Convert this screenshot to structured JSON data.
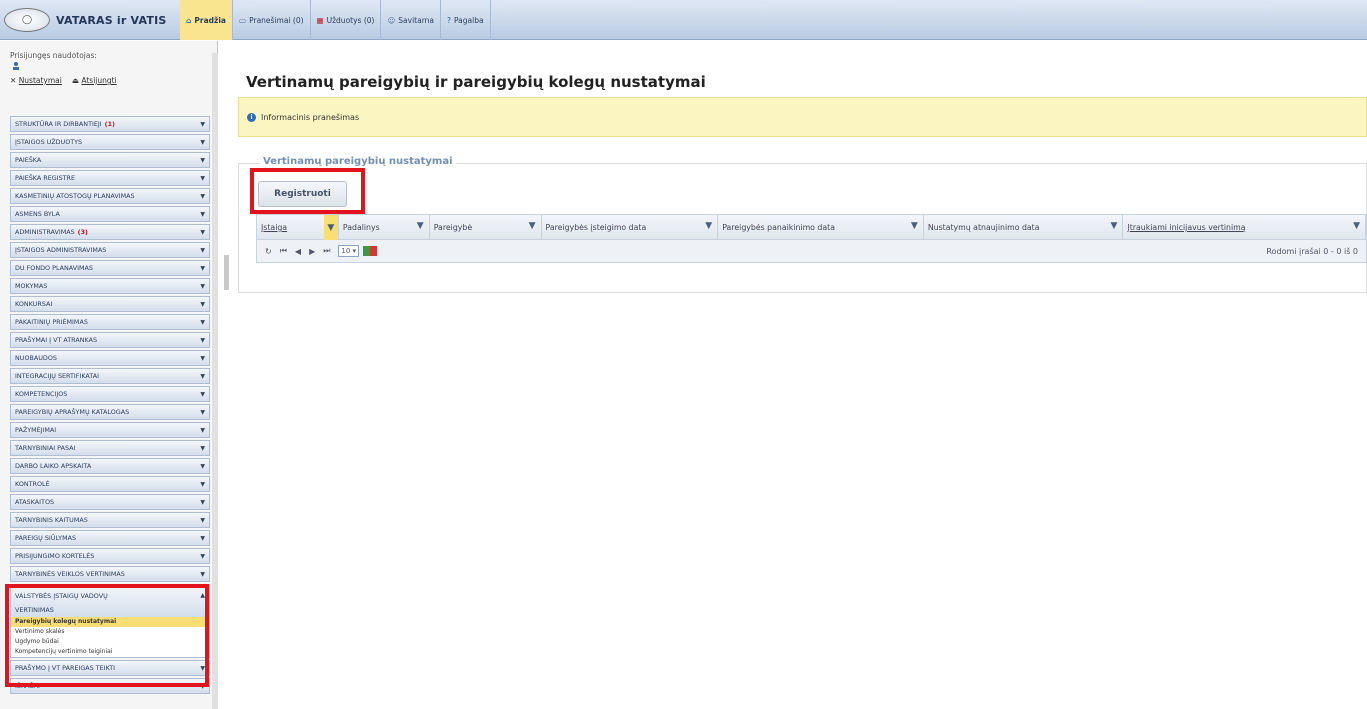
{
  "topbar": {
    "brand": "VATARAS ir VATIS",
    "logo_text": "◯",
    "nav": [
      {
        "label": "Pradžia",
        "active": true,
        "icon": "home-icon"
      },
      {
        "label": "Pranešimai (0)",
        "active": false,
        "icon": "message-icon"
      },
      {
        "label": "Užduotys (0)",
        "active": false,
        "icon": "calendar-icon"
      },
      {
        "label": "Savitarna",
        "active": false,
        "icon": "people-icon"
      },
      {
        "label": "Pagalba",
        "active": false,
        "icon": "help-icon"
      }
    ]
  },
  "sidebar": {
    "user_label": "Prisijungęs naudotojas:",
    "settings_link": "Nustatymai",
    "logout_link": "Atsijungti",
    "menu": [
      {
        "label": "STRUKTŪRA IR DIRBANTIEJI",
        "badge": "(1)"
      },
      {
        "label": "ĮSTAIGOS UŽDUOTYS",
        "badge": ""
      },
      {
        "label": "PAIEŠKA",
        "badge": ""
      },
      {
        "label": "PAIEŠKA REGISTRE",
        "badge": ""
      },
      {
        "label": "KASMETINIŲ ATOSTOGŲ PLANAVIMAS",
        "badge": ""
      },
      {
        "label": "ASMENS BYLA",
        "badge": ""
      },
      {
        "label": "ADMINISTRAVIMAS",
        "badge": "(3)"
      },
      {
        "label": "ĮSTAIGOS ADMINISTRAVIMAS",
        "badge": ""
      },
      {
        "label": "DU FONDO PLANAVIMAS",
        "badge": ""
      },
      {
        "label": "MOKYMAS",
        "badge": ""
      },
      {
        "label": "KONKURSAI",
        "badge": ""
      },
      {
        "label": "PAKAITINIŲ PRIĖMIMAS",
        "badge": ""
      },
      {
        "label": "PRAŠYMAI Į VT ATRANKAS",
        "badge": ""
      },
      {
        "label": "NUOBAUDOS",
        "badge": ""
      },
      {
        "label": "INTEGRACIJŲ SERTIFIKATAI",
        "badge": ""
      },
      {
        "label": "KOMPETENCIJOS",
        "badge": ""
      },
      {
        "label": "PAREIGYBIŲ APRAŠYMŲ KATALOGAS",
        "badge": ""
      },
      {
        "label": "PAŽYMĖJIMAI",
        "badge": ""
      },
      {
        "label": "TARNYBINIAI PASAI",
        "badge": ""
      },
      {
        "label": "DARBO LAIKO APSKAITA",
        "badge": ""
      },
      {
        "label": "KONTROLĖ",
        "badge": ""
      },
      {
        "label": "ATASKAITOS",
        "badge": ""
      },
      {
        "label": "TARNYBINIS KAITUMAS",
        "badge": ""
      },
      {
        "label": "PAREIGŲ SIŪLYMAS",
        "badge": ""
      },
      {
        "label": "PRISIJUNGIMO KORTELĖS",
        "badge": ""
      },
      {
        "label": "TARNYBINĖS VEIKLOS VERTINIMAS",
        "badge": ""
      }
    ],
    "expanded": {
      "label_line1": "VALSTYBĖS ĮSTAIGŲ VADOVŲ",
      "label_line2": "VERTINIMAS",
      "items": [
        {
          "label": "Pareigybių kolegų nustatymai",
          "selected": true
        },
        {
          "label": "Vertinimo skalės",
          "selected": false
        },
        {
          "label": "Ugdymo būdai",
          "selected": false
        },
        {
          "label": "Kompetencijų vertinimo teiginiai",
          "selected": false
        }
      ]
    },
    "after": [
      {
        "label": "PRAŠYMO Į VT PAREIGAS TEIKTI",
        "badge": ""
      },
      {
        "label": "IŠRAŠAI",
        "badge": ""
      }
    ]
  },
  "main": {
    "title": "Vertinamų pareigybių ir pareigybių kolegų nustatymai",
    "info": "Informacinis pranešimas",
    "panel_legend": "Vertinamų pareigybių nustatymai",
    "register_button": "Registruoti",
    "columns": [
      "Įstaiga",
      "Padalinys",
      "Pareigybė",
      "Pareigybės įsteigimo data",
      "Pareigybės panaikinimo data",
      "Nustatymų atnaujinimo data",
      "Įtraukiami inicijavus vertinimą"
    ],
    "pager": {
      "refresh": "↻",
      "first": "⏮",
      "prev": "◀",
      "next": "▶",
      "last": "⏭",
      "page_size": "10 ▾",
      "records": "Rodomi įrašai 0 - 0 iš 0"
    }
  },
  "colors": {
    "accent": "#e2131d",
    "selected": "#f8de74",
    "info_bg": "#fbf5c2"
  }
}
